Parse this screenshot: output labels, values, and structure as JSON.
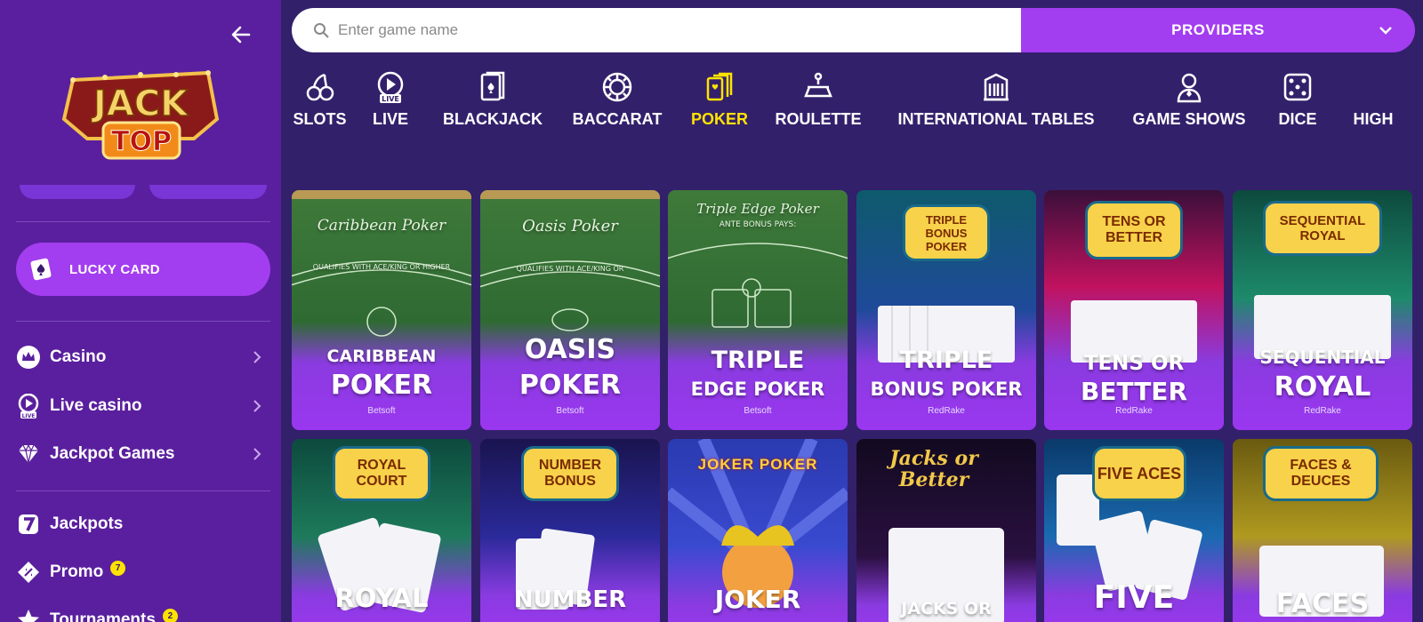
{
  "sidebar": {
    "logo": {
      "line1": "JACK",
      "line2": "TOP"
    },
    "lucky_card": {
      "label": "LUCKY CARD",
      "icon": "playing-card-icon"
    },
    "nav": [
      {
        "label": "Casino",
        "icon": "crown-icon"
      },
      {
        "label": "Live casino",
        "icon": "live-play-icon"
      },
      {
        "label": "Jackpot Games",
        "icon": "diamond-icon"
      }
    ],
    "extras": [
      {
        "label": "Jackpots",
        "icon": "seven-icon",
        "badge": ""
      },
      {
        "label": "Promo",
        "icon": "ticket-icon",
        "badge": "7"
      },
      {
        "label": "Tournaments",
        "icon": "star-icon",
        "badge": "2"
      }
    ]
  },
  "search": {
    "placeholder": "Enter game name",
    "providers_label": "PROVIDERS"
  },
  "categories": [
    {
      "label": "SLOTS",
      "icon": "cherries-icon"
    },
    {
      "label": "LIVE",
      "icon": "live-icon"
    },
    {
      "label": "BLACKJACK",
      "icon": "cards-icon"
    },
    {
      "label": "BACCARAT",
      "icon": "chip-icon"
    },
    {
      "label": "POKER",
      "icon": "poker-hand-icon",
      "active": true
    },
    {
      "label": "ROULETTE",
      "icon": "roulette-table-icon"
    },
    {
      "label": "INTERNATIONAL TABLES",
      "icon": "building-icon"
    },
    {
      "label": "GAME SHOWS",
      "icon": "host-icon"
    },
    {
      "label": "DICE",
      "icon": "dice-icon"
    },
    {
      "label": "HIGH",
      "icon": ""
    }
  ],
  "games": [
    {
      "table_script": "Caribbean Poker",
      "table_rule": "QUALIFIES WITH ACE/KING OR HIGHER",
      "name_small": "CARIBBEAN",
      "name_big": "POKER",
      "provider": "Betsoft"
    },
    {
      "table_script": "Oasis Poker",
      "table_rule": "QUALIFIES WITH ACE/KING OR",
      "name_small": "",
      "name_big": "OASIS POKER",
      "provider": "Betsoft"
    },
    {
      "table_script": "Triple Edge Poker",
      "table_rule": "ANTE BONUS PAYS:",
      "name_small": "TRIPLE",
      "name_big": "EDGE POKER",
      "provider": "Betsoft"
    },
    {
      "emblem": "TRIPLE BONUS POKER",
      "name_small": "TRIPLE",
      "name_big": "BONUS POKER",
      "provider": "RedRake"
    },
    {
      "emblem": "TENS OR BETTER",
      "name_small": "TENS OR",
      "name_big": "BETTER",
      "provider": "RedRake"
    },
    {
      "emblem": "SEQUENTIAL ROYAL",
      "name_small": "SEQUENTIAL",
      "name_big": "ROYAL",
      "provider": "RedRake"
    },
    {
      "emblem": "ROYAL COURT",
      "name_big": "ROYAL"
    },
    {
      "emblem": "NUMBER BONUS",
      "name_big": "NUMBER"
    },
    {
      "emblem": "JOKER POKER",
      "name_big": "JOKER"
    },
    {
      "emblem": "Jacks or Better",
      "name_big": "JACKS OR"
    },
    {
      "emblem": "FIVE ACES",
      "name_big": "FIVE"
    },
    {
      "emblem": "FACES & DEUCES",
      "name_big": "FACES"
    }
  ]
}
